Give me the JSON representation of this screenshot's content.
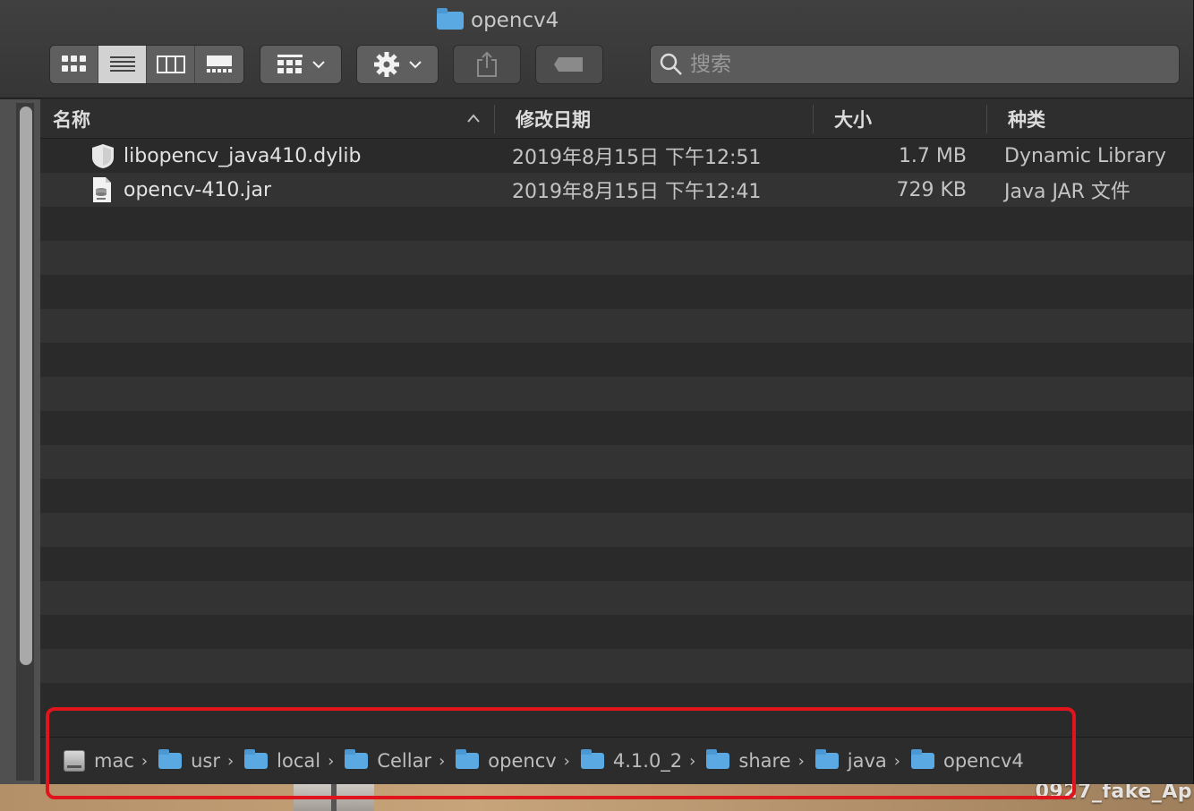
{
  "window": {
    "title": "opencv4"
  },
  "toolbar": {
    "view_modes": [
      "icon-view",
      "list-view",
      "column-view",
      "gallery-view"
    ],
    "active_view": "list-view"
  },
  "search": {
    "placeholder": "搜索"
  },
  "columns": {
    "name": "名称",
    "date": "修改日期",
    "size": "大小",
    "kind": "种类"
  },
  "files": [
    {
      "name": "libopencv_java410.dylib",
      "date": "2019年8月15日 下午12:51",
      "size": "1.7 MB",
      "kind": "Dynamic Library",
      "icon": "dylib-icon"
    },
    {
      "name": "opencv-410.jar",
      "date": "2019年8月15日 下午12:41",
      "size": "729 KB",
      "kind": "Java JAR 文件",
      "icon": "jar-icon"
    }
  ],
  "pathbar": [
    "mac",
    "usr",
    "local",
    "Cellar",
    "opencv",
    "4.1.0_2",
    "share",
    "java",
    "opencv4"
  ],
  "watermark": "0927_fake_Ap",
  "colors": {
    "accent_folder": "#5aa9e2",
    "highlight": "#e0141c"
  }
}
